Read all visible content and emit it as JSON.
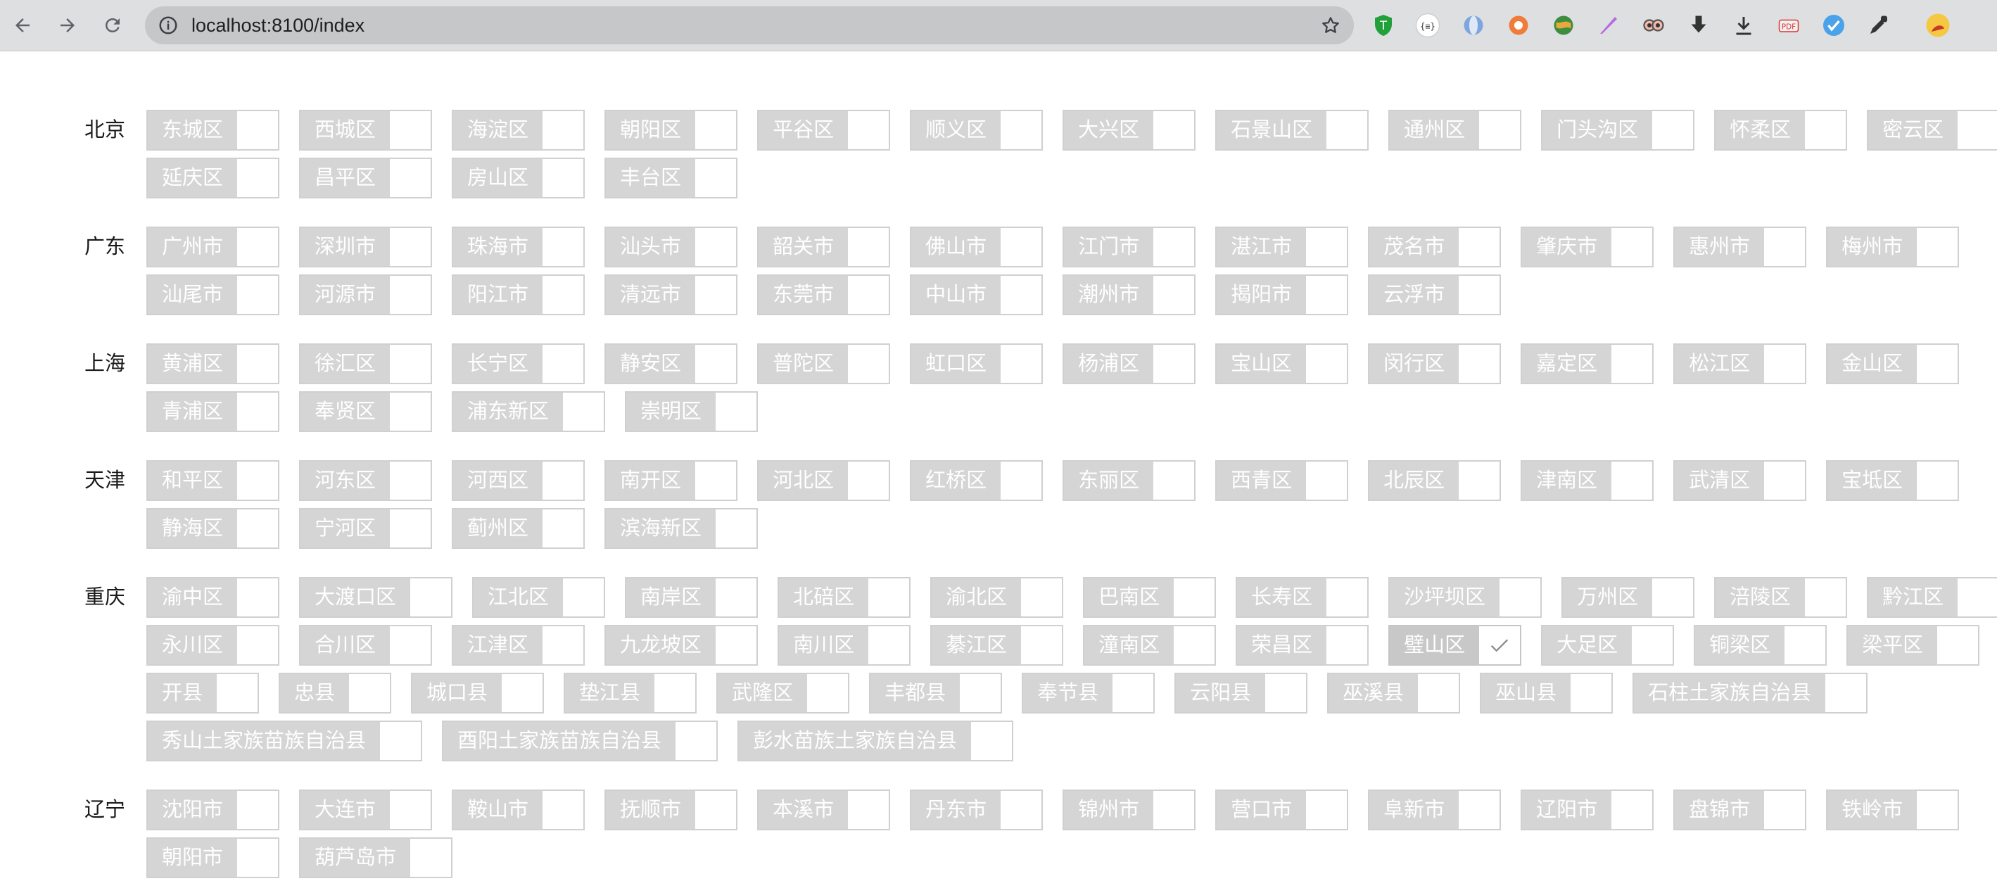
{
  "browser": {
    "url": "localhost:8100/index"
  },
  "provinces": [
    {
      "name": "北京",
      "districts": [
        "东城区",
        "西城区",
        "海淀区",
        "朝阳区",
        "平谷区",
        "顺义区",
        "大兴区",
        "石景山区",
        "通州区",
        "门头沟区",
        "怀柔区",
        "密云区",
        "延庆区",
        "昌平区",
        "房山区",
        "丰台区"
      ]
    },
    {
      "name": "广东",
      "districts": [
        "广州市",
        "深圳市",
        "珠海市",
        "汕头市",
        "韶关市",
        "佛山市",
        "江门市",
        "湛江市",
        "茂名市",
        "肇庆市",
        "惠州市",
        "梅州市",
        "汕尾市",
        "河源市",
        "阳江市",
        "清远市",
        "东莞市",
        "中山市",
        "潮州市",
        "揭阳市",
        "云浮市"
      ]
    },
    {
      "name": "上海",
      "districts": [
        "黄浦区",
        "徐汇区",
        "长宁区",
        "静安区",
        "普陀区",
        "虹口区",
        "杨浦区",
        "宝山区",
        "闵行区",
        "嘉定区",
        "松江区",
        "金山区",
        "青浦区",
        "奉贤区",
        "浦东新区",
        "崇明区"
      ]
    },
    {
      "name": "天津",
      "districts": [
        "和平区",
        "河东区",
        "河西区",
        "南开区",
        "河北区",
        "红桥区",
        "东丽区",
        "西青区",
        "北辰区",
        "津南区",
        "武清区",
        "宝坻区",
        "静海区",
        "宁河区",
        "蓟州区",
        "滨海新区"
      ]
    },
    {
      "name": "重庆",
      "districts": [
        "渝中区",
        "大渡口区",
        "江北区",
        "南岸区",
        "北碚区",
        "渝北区",
        "巴南区",
        "长寿区",
        "沙坪坝区",
        "万州区",
        "涪陵区",
        "黔江区",
        "永川区",
        "合川区",
        "江津区",
        "九龙坡区",
        "南川区",
        "綦江区",
        "潼南区",
        "荣昌区",
        "璧山区",
        "大足区",
        "铜梁区",
        "梁平区",
        "开县",
        "忠县",
        "城口县",
        "垫江县",
        "武隆区",
        "丰都县",
        "奉节县",
        "云阳县",
        "巫溪县",
        "巫山县",
        "石柱土家族自治县",
        "秀山土家族苗族自治县",
        "酉阳土家族苗族自治县",
        "彭水苗族土家族自治县"
      ],
      "checked": [
        "璧山区"
      ]
    },
    {
      "name": "辽宁",
      "districts": [
        "沈阳市",
        "大连市",
        "鞍山市",
        "抚顺市",
        "本溪市",
        "丹东市",
        "锦州市",
        "营口市",
        "阜新市",
        "辽阳市",
        "盘锦市",
        "铁岭市",
        "朝阳市",
        "葫芦岛市"
      ]
    }
  ],
  "icons": {
    "back": "arrow-left-icon",
    "forward": "arrow-right-icon",
    "reload": "reload-icon",
    "info": "info-icon",
    "star": "star-icon",
    "check": "checkmark-icon"
  },
  "colors": {
    "chip_label_bg": "#d5d5d5",
    "chip_label_text": "#ffffff",
    "chip_border": "#d0d0d0",
    "check": "#8a8a8a"
  }
}
